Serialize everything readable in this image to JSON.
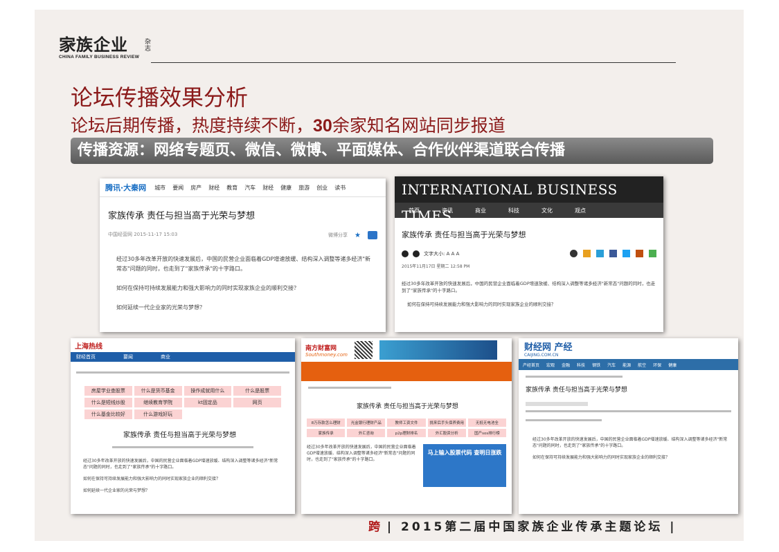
{
  "logo": {
    "main": "家族企业",
    "side": "杂志",
    "en": "CHINA FAMILY BUSINESS REVIEW"
  },
  "title": "论坛传播效果分析",
  "subtitle": {
    "prefix": "论坛后期传播，热度持续不断，",
    "number": "30",
    "suffix": "余家知名网站同步报道"
  },
  "banner": "传播资源：网络专题页、微信、微博、平面媒体、合作伙伴渠道联合传播",
  "shot1": {
    "logo": "腾讯·大秦网",
    "nav": [
      "城市",
      "要闻",
      "房产",
      "财经",
      "教育",
      "汽车",
      "财经",
      "健康",
      "旅游",
      "创业",
      "读书"
    ],
    "headline": "家族传承 责任与担当高于光荣与梦想",
    "meta": "中国经营网 2015-11-17 15:03",
    "share": "微博分享",
    "p1": "经过30多年改革开放的快速发展后，中国的民营企业面临着GDP增速放缓、结构深入调整等诸多经济\"新常态\"问题的同时，也走到了\"家族传承\"的十字路口。",
    "p2": "如何在保持可持续发展能力和强大影响力的同时实现家族企业的顺利交接？",
    "p3": "如何延续一代企业家的光荣与梦想？"
  },
  "shot2": {
    "logo": "INTERNATIONAL BUSINESS TIMES",
    "nav": [
      "首页",
      "资讯",
      "商业",
      "科技",
      "文化",
      "观点"
    ],
    "headline": "家族传承 责任与担当高于光荣与梦想",
    "fontsize": "文字大小: A A A",
    "date": "2015年11月17日 星期二 12:58 PM",
    "p1": "经过30多年改革开放的快速发展后，中国的民营企业面临着GDP增速放缓、结构深入调整等诸多经济\"新常态\"问题的同时，也走到了\"家族传承\"的十字路口。",
    "p2": "如何在保持可持续发展能力和强大影响力的同时实现家族企业的顺利交接？"
  },
  "shot3": {
    "logo": "上海热线",
    "nav": [
      "财经首页",
      "要闻",
      "商业"
    ],
    "boxes": [
      "房屋学业查股票",
      "什么是货币基金",
      "操作成就用什么",
      "什么是股票",
      "什么是短线炒股",
      "继续教育学院",
      "kt固定品",
      "网页",
      "什么基金比较好",
      "什么游戏好玩"
    ],
    "headline": "家族传承 责任与担当高于光荣与梦想",
    "p1": "经过30多年改革开放的快速发展后，中国的民营企业面临着GDP增速放缓、结构深入调整等诸多经济\"新常态\"问题的同时，也走到了\"家族传承\"的十字路口。",
    "p2": "如何在保持可持续发展能力和强大影响力的同时实现家族企业的顺利交接？",
    "p3": "如何延续一代企业家的光荣与梦想？"
  },
  "shot4": {
    "logo": "南方财富网",
    "logo_en": "Southmoney.com",
    "headline": "家族传承 责任与担当高于光荣与梦想",
    "boxes": [
      "8万存款怎么理财",
      "光金银行理财产品",
      "教师工资文件",
      "挑来后手头保养费用",
      "无抵无电池全",
      "家族传承",
      "外汇咨询",
      "p2p理财排名",
      "外汇股资分析",
      "国产sos排行榜"
    ],
    "promo": "马上输入股票代码 查明日涨跌",
    "p1": "经过30多年改革开放的快速发展后，中国的民营企业面临着GDP增速放缓、结构深入调整等诸多经济\"新常态\"问题的同时，也走到了\"家族传承\"的十字路口。"
  },
  "shot5": {
    "logo": "财经网 产经",
    "logo_en": "CAIJING.COM.CN",
    "nav": [
      "产经首页",
      "宏观",
      "金融",
      "科技",
      "钢铁",
      "汽车",
      "能源",
      "航空",
      "环保",
      "健康"
    ],
    "headline": "家族传承 责任与担当高于光荣与梦想",
    "p1": "经过30多年改革开放的快速发展后，中国的民营企业面临着GDP增速放缓、结构深入调整等诸多经济\"新常态\"问题的同时，也走到了\"家族传承\"的十字路口。",
    "p2": "如何在保持可持续发展能力和强大影响力的同时实现家族企业的顺利交接？"
  },
  "footer": {
    "glyph": "跨",
    "text": "| 2015第二届中国家族企业传承主题论坛 |"
  }
}
